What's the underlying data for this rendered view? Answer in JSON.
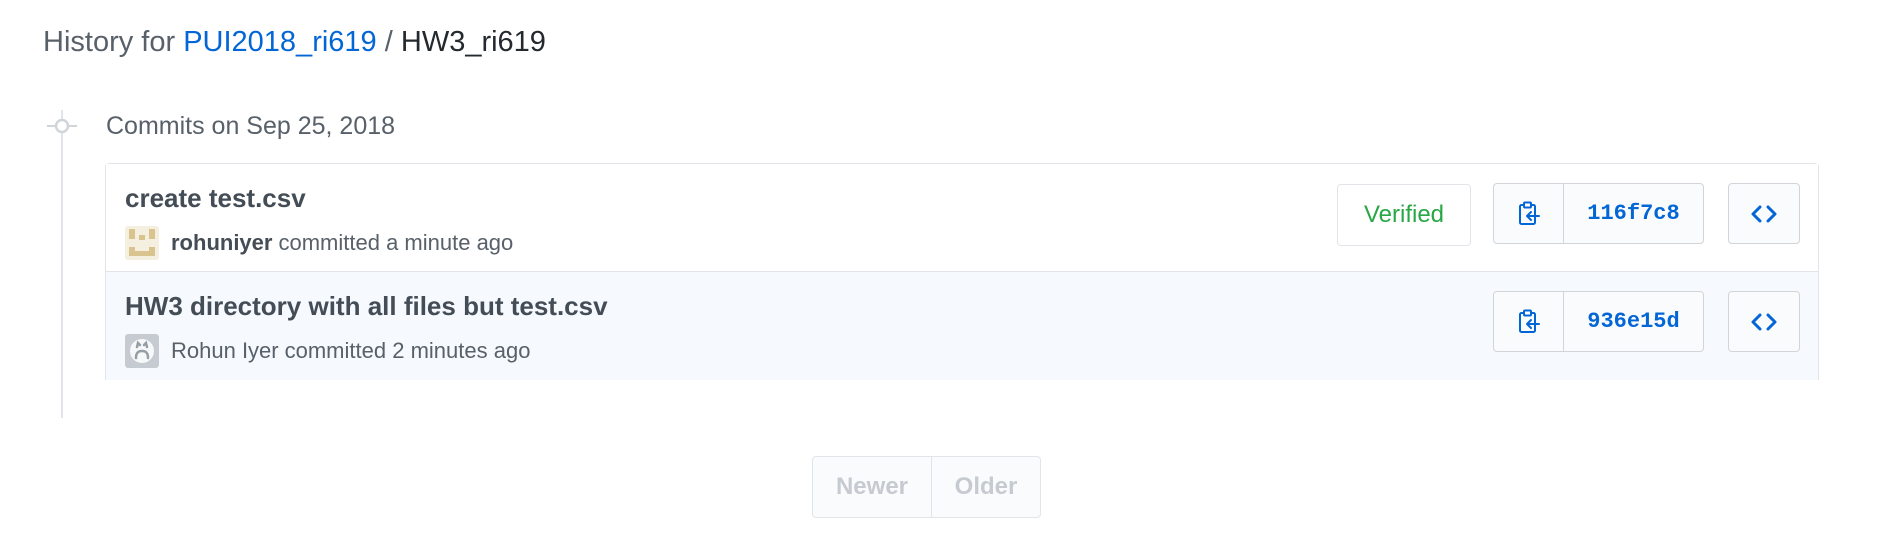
{
  "header": {
    "prefix": "History for",
    "repo_name": "PUI2018_ri619",
    "separator": "/",
    "path": "HW3_ri619"
  },
  "timeline": {
    "date_label": "Commits on Sep 25, 2018"
  },
  "commits": [
    {
      "message": "create test.csv",
      "author": "rohuniyer",
      "action": "committed",
      "time": "a minute ago",
      "verified_label": "Verified",
      "sha": "116f7c8",
      "avatar_icon": "identicon-avatar"
    },
    {
      "message": "HW3 directory with all files but test.csv",
      "author": "Rohun Iyer",
      "action": "committed",
      "time": "2 minutes ago",
      "sha": "936e15d",
      "avatar_icon": "octocat-avatar"
    }
  ],
  "pagination": {
    "newer_label": "Newer",
    "older_label": "Older"
  },
  "colors": {
    "link": "#0366d6",
    "verified": "#28a745",
    "disabled": "#c6cbd1"
  }
}
